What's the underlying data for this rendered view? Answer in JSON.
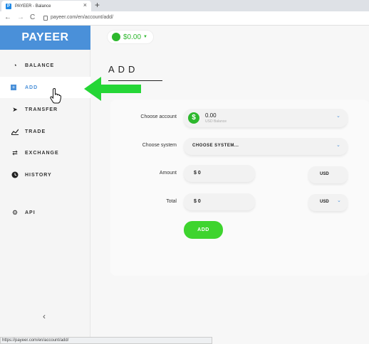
{
  "browser": {
    "tab_title": "PAYEER - Balance",
    "tab_favicon": "P",
    "tab_close": "×",
    "new_tab": "+",
    "back": "←",
    "forward": "→",
    "reload": "C",
    "url": "payeer.com/en/account/add/",
    "status_url": "https://payeer.com/en/account/add/"
  },
  "brand": {
    "logo": "PAYEER",
    "accent": "#4a90d9",
    "green": "#3ed42e"
  },
  "balance": {
    "amount": "$0.00",
    "caret": "▼"
  },
  "sidebar": {
    "items": [
      {
        "label": "BALANCE",
        "icon": "speedometer-icon",
        "glyph": "◔"
      },
      {
        "label": "ADD",
        "icon": "plus-square-icon",
        "glyph": "+"
      },
      {
        "label": "TRANSFER",
        "icon": "paper-plane-icon",
        "glyph": "➤"
      },
      {
        "label": "TRADE",
        "icon": "chart-icon",
        "glyph": "📈"
      },
      {
        "label": "EXCHANGE",
        "icon": "exchange-icon",
        "glyph": "⇄"
      },
      {
        "label": "HISTORY",
        "icon": "clock-icon",
        "glyph": "◷"
      },
      {
        "label": "API",
        "icon": "gears-icon",
        "glyph": "⚙"
      }
    ],
    "collapse": "‹"
  },
  "page": {
    "title": "ADD"
  },
  "form": {
    "account_label": "Choose account",
    "account_value": "0.00",
    "account_sub": "USD Balance",
    "account_icon": "$",
    "system_label": "Choose system",
    "system_placeholder": "CHOOSE SYSTEM...",
    "amount_label": "Amount",
    "amount_value": "$ 0",
    "amount_currency": "USD",
    "total_label": "Total",
    "total_value": "$ 0",
    "total_currency": "USD",
    "chevron": "⌄",
    "submit": "ADD"
  }
}
